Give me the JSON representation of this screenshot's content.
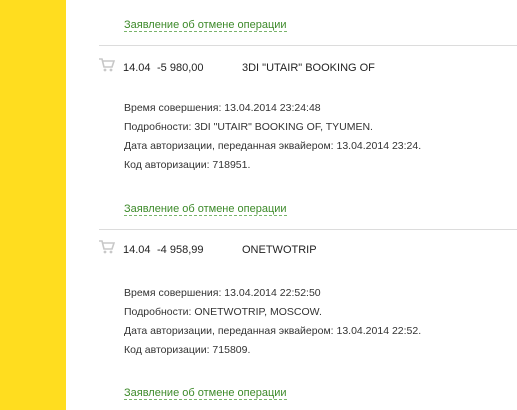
{
  "dispute_link_label": "Заявление об отмене операции",
  "transactions": [
    {
      "date": "14.04",
      "amount": "-5 980,00",
      "merchant": "3DI \"UTAIR\" BOOKING OF",
      "details": [
        "Время совершения:  13.04.2014 23:24:48",
        "Подробности: 3DI \"UTAIR\" BOOKING OF, TYUMEN.",
        "Дата авторизации, переданная эквайером: 13.04.2014 23:24.",
        "Код авторизации: 718951."
      ]
    },
    {
      "date": "14.04",
      "amount": "-4 958,99",
      "merchant": "ONETWOTRIP",
      "details": [
        "Время совершения:  13.04.2014 22:52:50",
        "Подробности: ONETWOTRIP, MOSCOW.",
        "Дата авторизации, переданная эквайером: 13.04.2014 22:52.",
        "Код авторизации: 715809."
      ]
    }
  ],
  "colors": {
    "sidebar": "#ffdd1f",
    "link": "#3d8a2a",
    "divider": "#dcdcdc",
    "icon": "#c8c8c8"
  }
}
